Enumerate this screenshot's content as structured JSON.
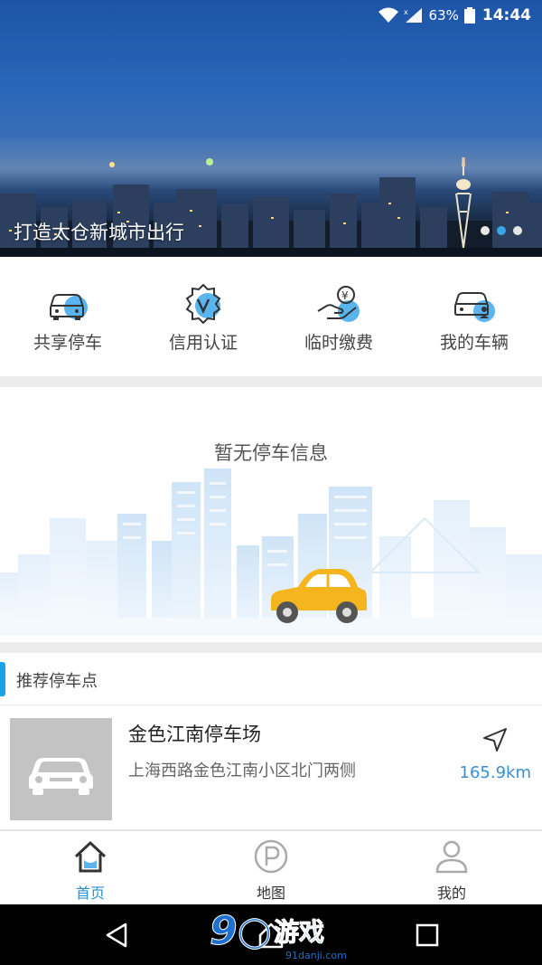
{
  "status_bar": {
    "battery_percent": "63%",
    "time": "14:44"
  },
  "banner": {
    "caption": "打造太仓新城市出行",
    "dots_total": 3,
    "active_dot": 1
  },
  "quick_actions": [
    {
      "label": "共享停车",
      "icon": "shared-parking-car-icon"
    },
    {
      "label": "信用认证",
      "icon": "credit-badge-icon"
    },
    {
      "label": "临时缴费",
      "icon": "payment-hand-coin-icon"
    },
    {
      "label": "我的车辆",
      "icon": "my-car-user-icon"
    }
  ],
  "empty_state": {
    "message": "暂无停车信息"
  },
  "recommended": {
    "title": "推荐停车点",
    "items": [
      {
        "name": "金色江南停车场",
        "address": "上海西路金色江南小区北门两侧",
        "distance": "165.9km"
      }
    ]
  },
  "tabs": [
    {
      "label": "首页",
      "icon": "home-icon",
      "active": true
    },
    {
      "label": "地图",
      "icon": "parking-p-icon",
      "active": false
    },
    {
      "label": "我的",
      "icon": "user-icon",
      "active": false
    }
  ],
  "watermark": {
    "number": "9",
    "text": "游戏",
    "sub": "91danji.com"
  },
  "colors": {
    "accent": "#2a8fd0",
    "icon_blue": "#5ab4ef",
    "car_yellow": "#f5b51f"
  }
}
